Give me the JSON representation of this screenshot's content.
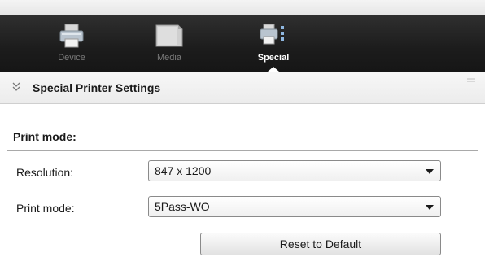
{
  "toolbar": {
    "tabs": [
      {
        "label": "Device",
        "icon": "printer-icon",
        "active": false
      },
      {
        "label": "Media",
        "icon": "media-icon",
        "active": false
      },
      {
        "label": "Special",
        "icon": "special-settings-icon",
        "active": true
      }
    ]
  },
  "section": {
    "title": "Special Printer Settings",
    "collapse_icon": "chevron-double-down-icon"
  },
  "print_mode_group": {
    "heading": "Print mode:",
    "fields": [
      {
        "label": "Resolution:",
        "value": "847 x 1200"
      },
      {
        "label": "Print mode:",
        "value": "5Pass-WO"
      }
    ],
    "reset_button_label": "Reset to Default"
  },
  "colors": {
    "toolbar_bg": "#1c1c1c",
    "active_tab_text": "#ffffff",
    "inactive_tab_text": "#7b7b7b",
    "panel_header_bg": "#ececec"
  }
}
